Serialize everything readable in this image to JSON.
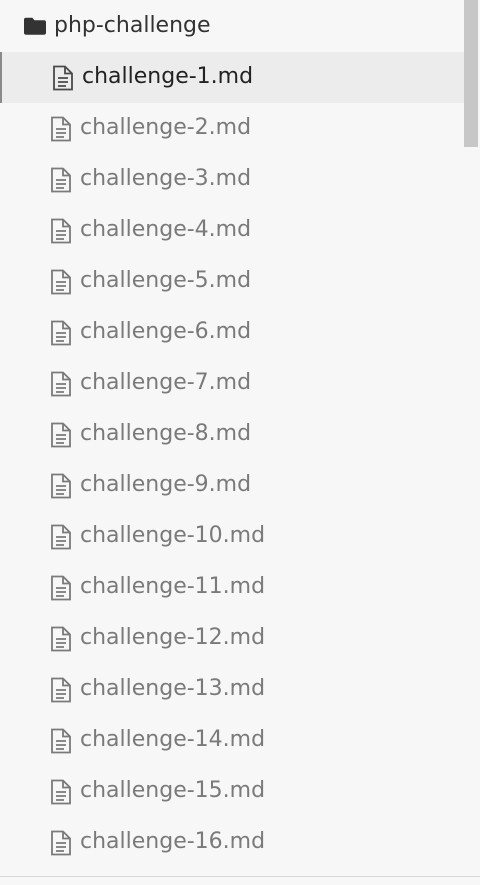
{
  "folder": {
    "name": "php-challenge",
    "icon": "folder-icon"
  },
  "files": [
    {
      "name": "challenge-1.md",
      "icon": "file-text-icon",
      "active": true
    },
    {
      "name": "challenge-2.md",
      "icon": "file-text-icon",
      "active": false
    },
    {
      "name": "challenge-3.md",
      "icon": "file-text-icon",
      "active": false
    },
    {
      "name": "challenge-4.md",
      "icon": "file-text-icon",
      "active": false
    },
    {
      "name": "challenge-5.md",
      "icon": "file-text-icon",
      "active": false
    },
    {
      "name": "challenge-6.md",
      "icon": "file-text-icon",
      "active": false
    },
    {
      "name": "challenge-7.md",
      "icon": "file-text-icon",
      "active": false
    },
    {
      "name": "challenge-8.md",
      "icon": "file-text-icon",
      "active": false
    },
    {
      "name": "challenge-9.md",
      "icon": "file-text-icon",
      "active": false
    },
    {
      "name": "challenge-10.md",
      "icon": "file-text-icon",
      "active": false
    },
    {
      "name": "challenge-11.md",
      "icon": "file-text-icon",
      "active": false
    },
    {
      "name": "challenge-12.md",
      "icon": "file-text-icon",
      "active": false
    },
    {
      "name": "challenge-13.md",
      "icon": "file-text-icon",
      "active": false
    },
    {
      "name": "challenge-14.md",
      "icon": "file-text-icon",
      "active": false
    },
    {
      "name": "challenge-15.md",
      "icon": "file-text-icon",
      "active": false
    },
    {
      "name": "challenge-16.md",
      "icon": "file-text-icon",
      "active": false
    }
  ],
  "colors": {
    "background": "#f7f7f7",
    "active_background": "#ececec",
    "active_text": "#222222",
    "inactive_text": "#7a7a7a",
    "scrollbar_thumb": "#c7c7c7"
  }
}
